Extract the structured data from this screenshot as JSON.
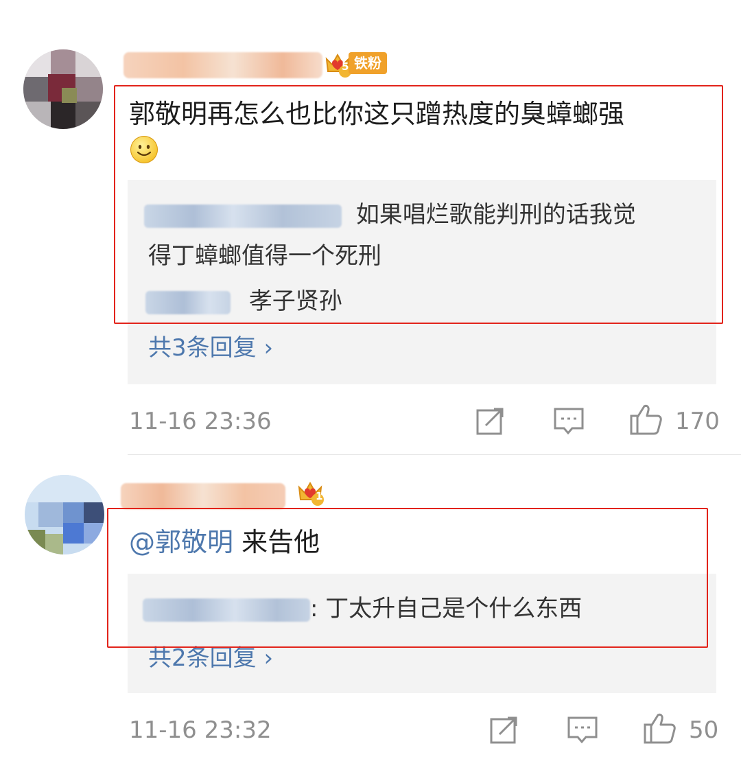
{
  "header": {
    "fragment": "…"
  },
  "comments": [
    {
      "fan_badge": "铁粉",
      "fan_level": "5",
      "text": "郭敬明再怎么也比你这只蹭热度的臭蟑螂强",
      "replies": [
        {
          "line1": "如果唱烂歌能判刑的话我觉",
          "line2": "得丁蟑螂值得一个死刑"
        },
        {
          "line1": "孝子贤孙"
        }
      ],
      "total_replies": "共3条回复 ›",
      "time": "11-16 23:36",
      "likes": "170"
    },
    {
      "fan_level": "1",
      "mention": "@郭敬明",
      "text": " 来告他",
      "replies": [
        {
          "line1": ": 丁太升自己是个什么东西"
        }
      ],
      "total_replies": "共2条回复 ›",
      "time": "11-16 23:32",
      "likes": "50"
    }
  ],
  "icons": {
    "share": "share-icon",
    "comment": "comment-icon",
    "like": "thumbs-up-icon",
    "smiley": "smiley-emoji-icon",
    "crown": "crown-badge-icon"
  },
  "colors": {
    "link": "#4e78ad",
    "highlight": "#e2231a",
    "badge": "#f0a12a",
    "meta": "#8f8f8f"
  }
}
